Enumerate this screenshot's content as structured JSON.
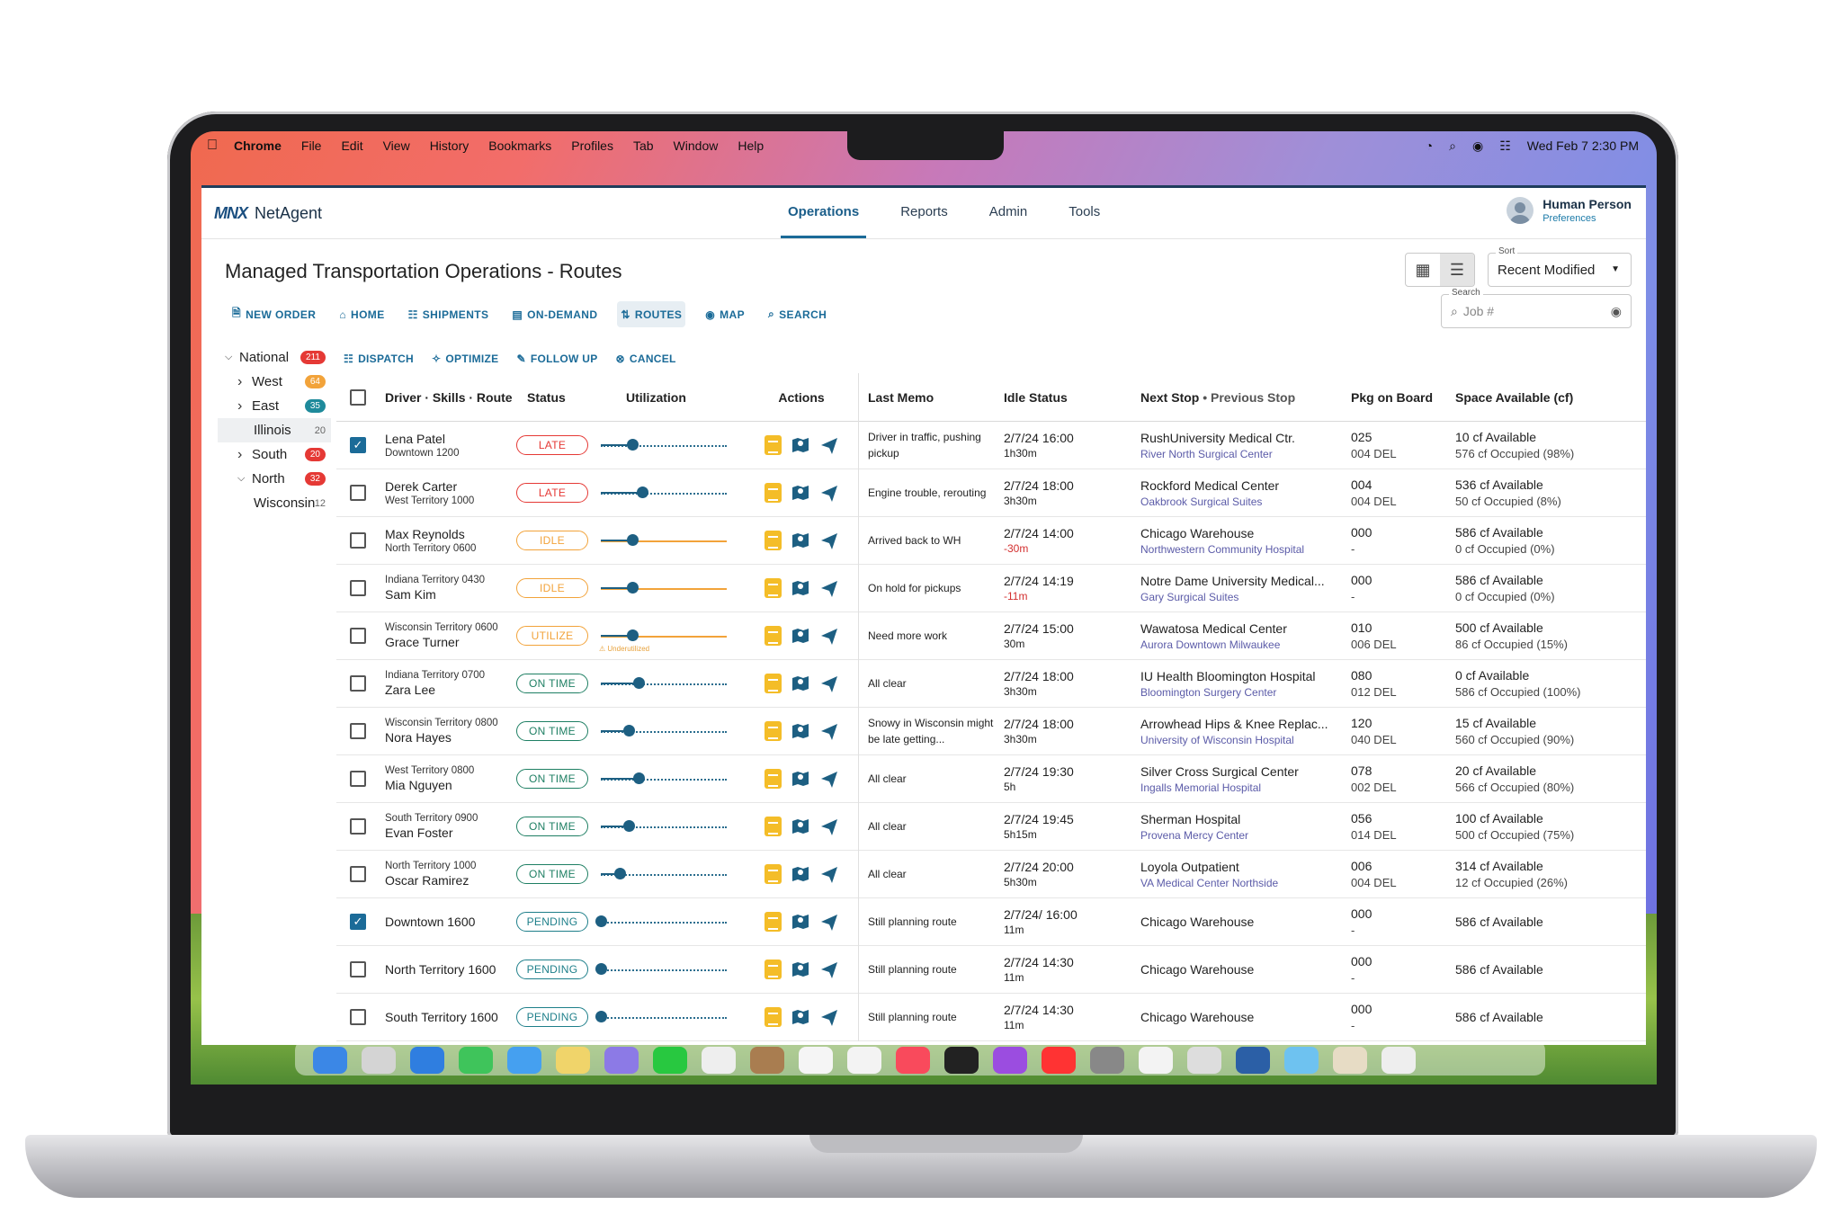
{
  "menubar": {
    "app": "Chrome",
    "items": [
      "File",
      "Edit",
      "View",
      "History",
      "Bookmarks",
      "Profiles",
      "Tab",
      "Window",
      "Help"
    ],
    "datetime": "Wed Feb 7  2:30 PM"
  },
  "app": {
    "logo_mark": "MNX",
    "logo_name": "NetAgent",
    "nav": [
      "Operations",
      "Reports",
      "Admin",
      "Tools"
    ],
    "user_name": "Human Person",
    "user_pref": "Preferences",
    "title": "Managed Transportation Operations - Routes",
    "sort_label": "Sort",
    "sort_value": "Recent Modified",
    "search_label": "Search",
    "search_placeholder": "Job #",
    "toolbar": [
      "NEW ORDER",
      "HOME",
      "SHIPMENTS",
      "ON-DEMAND",
      "ROUTES",
      "MAP",
      "SEARCH"
    ],
    "actions": [
      "DISPATCH",
      "OPTIMIZE",
      "FOLLOW UP",
      "CANCEL"
    ]
  },
  "sidebar": [
    {
      "label": "National",
      "count": "211",
      "chev": "v",
      "badge": "#e53935",
      "indent": 0
    },
    {
      "label": "West",
      "count": "64",
      "chev": ">",
      "badge": "#f2a33a",
      "indent": 1
    },
    {
      "label": "East",
      "count": "35",
      "chev": ">",
      "badge": "#1e8a9b",
      "indent": 1
    },
    {
      "label": "Illinois",
      "count": "20",
      "chev": "",
      "badge": "",
      "indent": 2,
      "selected": true
    },
    {
      "label": "South",
      "count": "20",
      "chev": ">",
      "badge": "#e53935",
      "indent": 1
    },
    {
      "label": "North",
      "count": "32",
      "chev": "v",
      "badge": "#e53935",
      "indent": 1
    },
    {
      "label": "Wisconsin",
      "count": "12",
      "chev": "",
      "badge": "",
      "indent": 2
    }
  ],
  "headers": {
    "driver": "Driver · Skills · Route",
    "status": "Status",
    "util": "Utilization",
    "actions": "Actions",
    "memo": "Last Memo",
    "idle": "Idle Status",
    "next": "Next Stop",
    "prev": "• Previous Stop",
    "pkg": "Pkg on Board",
    "space": "Space Available (cf)"
  },
  "status_colors": {
    "LATE": "#e53935",
    "IDLE": "#f2a33a",
    "UTILIZE": "#f2a33a",
    "ON TIME": "#1e7f63",
    "PENDING": "#1e7f8a"
  },
  "rows": [
    {
      "checked": true,
      "name": "Lena Patel",
      "route": "Downtown 1200",
      "order": "name-first",
      "status": "LATE",
      "util": 0.25,
      "memo": "Driver in traffic, pushing pickup",
      "idle_time": "2/7/24 16:00",
      "idle_dur": "1h30m",
      "idle_neg": false,
      "next": "RushUniversity Medical Ctr.",
      "prev": "River North Surgical Center",
      "pkg": "025",
      "del": "004 DEL",
      "avail": "10 cf Available",
      "occ": "576 cf Occupied (98%)"
    },
    {
      "checked": false,
      "name": "Derek Carter",
      "route": "West Territory 1000",
      "order": "name-first",
      "status": "LATE",
      "util": 0.33,
      "memo": "Engine trouble, rerouting",
      "idle_time": "2/7/24 18:00",
      "idle_dur": "3h30m",
      "idle_neg": false,
      "next": "Rockford Medical Center",
      "prev": "Oakbrook Surgical Suites",
      "pkg": "004",
      "del": "004 DEL",
      "avail": "536 cf Available",
      "occ": "50 cf Occupied (8%)"
    },
    {
      "checked": false,
      "name": "Max Reynolds",
      "route": "North Territory 0600",
      "order": "name-first",
      "status": "IDLE",
      "util": 0.25,
      "memo": "Arrived back to WH",
      "idle_time": "2/7/24 14:00",
      "idle_dur": "-30m",
      "idle_neg": true,
      "next": "Chicago Warehouse",
      "prev": "Northwestern Community Hospital",
      "pkg": "000",
      "del": "-",
      "avail": "586 cf Available",
      "occ": "0 cf Occupied (0%)"
    },
    {
      "checked": false,
      "name": "Sam Kim",
      "route": "Indiana Territory 0430",
      "order": "route-first",
      "status": "IDLE",
      "util": 0.25,
      "memo": "On hold for pickups",
      "idle_time": "2/7/24 14:19",
      "idle_dur": "-11m",
      "idle_neg": true,
      "next": "Notre Dame University Medical...",
      "prev": "Gary Surgical Suites",
      "pkg": "000",
      "del": "-",
      "avail": "586 cf Available",
      "occ": "0 cf Occupied (0%)"
    },
    {
      "checked": false,
      "name": "Grace Turner",
      "route": "Wisconsin Territory 0600",
      "order": "route-first",
      "status": "UTILIZE",
      "util": 0.25,
      "warn": "Underutilized",
      "memo": "Need more work",
      "idle_time": "2/7/24 15:00",
      "idle_dur": "30m",
      "idle_neg": false,
      "next": "Wawatosa Medical Center",
      "prev": "Aurora Downtown Milwaukee",
      "pkg": "010",
      "del": "006 DEL",
      "avail": "500 cf Available",
      "occ": "86 cf Occupied (15%)"
    },
    {
      "checked": false,
      "name": "Zara Lee",
      "route": "Indiana Territory 0700",
      "order": "route-first",
      "status": "ON TIME",
      "util": 0.3,
      "memo": "All clear",
      "idle_time": "2/7/24 18:00",
      "idle_dur": "3h30m",
      "idle_neg": false,
      "next": "IU Health Bloomington Hospital",
      "prev": "Bloomington Surgery Center",
      "pkg": "080",
      "del": "012 DEL",
      "avail": "0 cf Available",
      "occ": "586 cf Occupied (100%)"
    },
    {
      "checked": false,
      "name": "Nora Hayes",
      "route": "Wisconsin Territory 0800",
      "order": "route-first",
      "status": "ON TIME",
      "util": 0.22,
      "memo": "Snowy in Wisconsin might be late getting...",
      "idle_time": "2/7/24 18:00",
      "idle_dur": "3h30m",
      "idle_neg": false,
      "next": "Arrowhead Hips & Knee Replac...",
      "prev": "University of Wisconsin Hospital",
      "pkg": "120",
      "del": "040 DEL",
      "avail": "15 cf Available",
      "occ": "560 cf Occupied (90%)"
    },
    {
      "checked": false,
      "name": "Mia Nguyen",
      "route": "West Territory 0800",
      "order": "route-first",
      "status": "ON TIME",
      "util": 0.3,
      "memo": "All clear",
      "idle_time": "2/7/24 19:30",
      "idle_dur": "5h",
      "idle_neg": false,
      "next": "Silver Cross Surgical Center",
      "prev": "Ingalls Memorial Hospital",
      "pkg": "078",
      "del": "002 DEL",
      "avail": "20 cf Available",
      "occ": "566 cf Occupied (80%)"
    },
    {
      "checked": false,
      "name": "Evan Foster",
      "route": "South Territory 0900",
      "order": "route-first",
      "status": "ON TIME",
      "util": 0.22,
      "memo": "All clear",
      "idle_time": "2/7/24 19:45",
      "idle_dur": "5h15m",
      "idle_neg": false,
      "next": "Sherman Hospital",
      "prev": "Provena Mercy Center",
      "pkg": "056",
      "del": "014 DEL",
      "avail": "100 cf Available",
      "occ": "500 cf Occupied (75%)"
    },
    {
      "checked": false,
      "name": "Oscar Ramirez",
      "route": "North Territory 1000",
      "order": "route-first",
      "status": "ON TIME",
      "util": 0.15,
      "memo": "All clear",
      "idle_time": "2/7/24 20:00",
      "idle_dur": "5h30m",
      "idle_neg": false,
      "next": "Loyola Outpatient",
      "prev": "VA Medical Center Northside",
      "pkg": "006",
      "del": "004 DEL",
      "avail": "314 cf Available",
      "occ": "12 cf Occupied (26%)"
    },
    {
      "checked": true,
      "name": "Downtown 1600",
      "route": "",
      "order": "single",
      "status": "PENDING",
      "util": 0.0,
      "memo": "Still planning route",
      "idle_time": "2/7/24/ 16:00",
      "idle_dur": "11m",
      "idle_neg": false,
      "next": "Chicago Warehouse",
      "prev": "",
      "pkg": "000",
      "del": "-",
      "avail": "586 cf Available",
      "occ": ""
    },
    {
      "checked": false,
      "name": "North Territory 1600",
      "route": "",
      "order": "single",
      "status": "PENDING",
      "util": 0.0,
      "memo": "Still planning route",
      "idle_time": "2/7/24 14:30",
      "idle_dur": "11m",
      "idle_neg": false,
      "next": "Chicago Warehouse",
      "prev": "",
      "pkg": "000",
      "del": "-",
      "avail": "586 cf Available",
      "occ": ""
    },
    {
      "checked": false,
      "name": "South Territory 1600",
      "route": "",
      "order": "single",
      "status": "PENDING",
      "util": 0.0,
      "memo": "Still planning route",
      "idle_time": "2/7/24 14:30",
      "idle_dur": "11m",
      "idle_neg": false,
      "next": "Chicago Warehouse",
      "prev": "",
      "pkg": "000",
      "del": "-",
      "avail": "586 cf Available",
      "occ": ""
    }
  ]
}
